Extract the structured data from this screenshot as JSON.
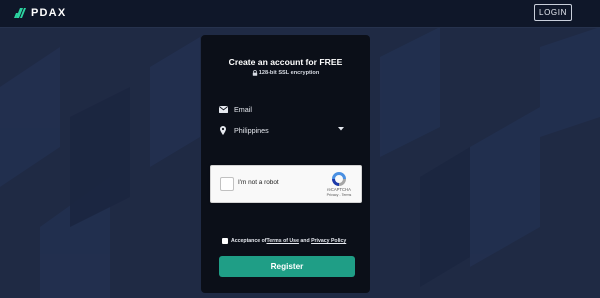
{
  "brand": {
    "name": "PDAX"
  },
  "header": {
    "login_label": "LOGIN"
  },
  "form": {
    "title": "Create an account for FREE",
    "ssl_note": "128-bit SSL encryption",
    "email_placeholder": "Email",
    "country_value": "Philippines",
    "recaptcha": {
      "label": "I'm not a robot",
      "brand": "reCAPTCHA",
      "privacy": "Privacy",
      "separator": " - ",
      "terms": "Terms"
    },
    "acceptance": {
      "prefix": "Acceptance of ",
      "terms_link": "Terms of Use",
      "and": " and ",
      "privacy_link": "Privacy Policy"
    },
    "register_label": "Register"
  },
  "colors": {
    "page_bg": "#1f2a44",
    "topbar_bg": "#0f1729",
    "card_bg": "#0b0f18",
    "accent_green": "#1f9e86",
    "logo_green": "#2bd4a0"
  },
  "icons": [
    "pdax-logo-icon",
    "lock-icon",
    "envelope-icon",
    "map-pin-icon",
    "caret-down-icon",
    "recaptcha-logo-icon"
  ]
}
